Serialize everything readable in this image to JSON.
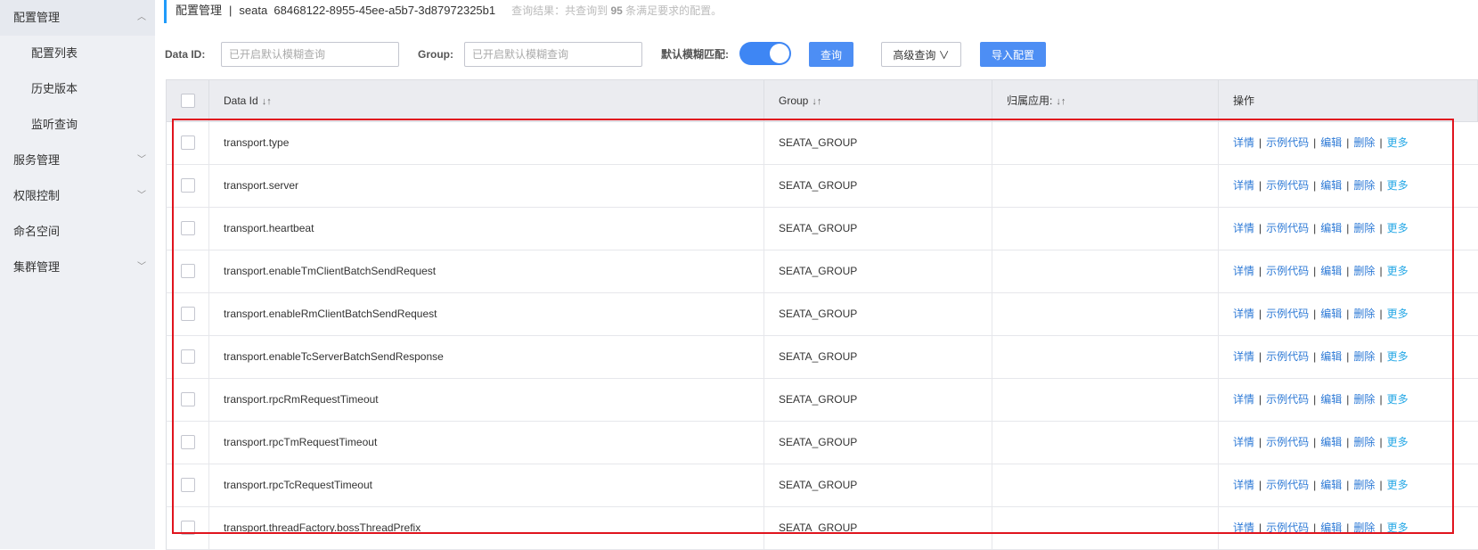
{
  "sidebar": {
    "items": [
      {
        "label": "配置管理",
        "chevron": "︿",
        "type": "parent"
      },
      {
        "label": "配置列表",
        "type": "sub"
      },
      {
        "label": "历史版本",
        "type": "sub"
      },
      {
        "label": "监听查询",
        "type": "sub"
      },
      {
        "label": "服务管理",
        "chevron": "﹀",
        "type": "parent"
      },
      {
        "label": "权限控制",
        "chevron": "﹀",
        "type": "parent"
      },
      {
        "label": "命名空间",
        "type": "parent"
      },
      {
        "label": "集群管理",
        "chevron": "﹀",
        "type": "parent"
      }
    ]
  },
  "header": {
    "title": "配置管理",
    "separator": "|",
    "namespace": "seata  68468122-8955-45ee-a5b7-3d87972325b1",
    "hint_prefix": "查询结果：共查询到",
    "hint_count": "95",
    "hint_suffix": "条满足要求的配置。"
  },
  "search": {
    "dataid_label": "Data ID:",
    "dataid_placeholder": "已开启默认模糊查询",
    "group_label": "Group:",
    "group_placeholder": "已开启默认模糊查询",
    "fuzzy_label": "默认模糊匹配:",
    "fuzzy_on": true,
    "query_button": "查询",
    "advanced_button": "高级查询",
    "advanced_chevron": "∨",
    "import_button": "导入配置"
  },
  "table": {
    "columns": {
      "dataid": "Data Id",
      "group": "Group",
      "app": "归属应用:",
      "ops": "操作",
      "sort_icon": "↓↑"
    },
    "ops_labels": {
      "detail": "详情",
      "sample": "示例代码",
      "edit": "编辑",
      "delete": "删除",
      "more": "更多",
      "sep": "|"
    },
    "rows": [
      {
        "dataid": "transport.type",
        "group": "SEATA_GROUP",
        "app": ""
      },
      {
        "dataid": "transport.server",
        "group": "SEATA_GROUP",
        "app": ""
      },
      {
        "dataid": "transport.heartbeat",
        "group": "SEATA_GROUP",
        "app": ""
      },
      {
        "dataid": "transport.enableTmClientBatchSendRequest",
        "group": "SEATA_GROUP",
        "app": ""
      },
      {
        "dataid": "transport.enableRmClientBatchSendRequest",
        "group": "SEATA_GROUP",
        "app": ""
      },
      {
        "dataid": "transport.enableTcServerBatchSendResponse",
        "group": "SEATA_GROUP",
        "app": ""
      },
      {
        "dataid": "transport.rpcRmRequestTimeout",
        "group": "SEATA_GROUP",
        "app": ""
      },
      {
        "dataid": "transport.rpcTmRequestTimeout",
        "group": "SEATA_GROUP",
        "app": ""
      },
      {
        "dataid": "transport.rpcTcRequestTimeout",
        "group": "SEATA_GROUP",
        "app": ""
      },
      {
        "dataid": "transport.threadFactory.bossThreadPrefix",
        "group": "SEATA_GROUP",
        "app": ""
      }
    ]
  },
  "colors": {
    "accent": "#209bfa",
    "primary_button": "#4d8ef4",
    "link": "#2e7ad6",
    "highlight_box": "#e0141e",
    "sidebar_bg": "#eef0f4"
  }
}
